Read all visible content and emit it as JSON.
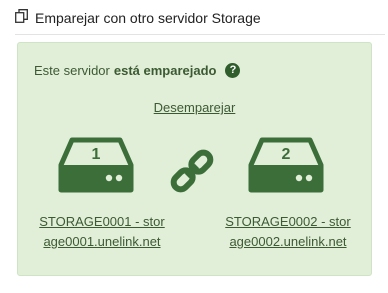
{
  "header": {
    "icon": "copy-icon",
    "title": "Emparejar con otro servidor Storage"
  },
  "pairing": {
    "status_prefix": "Este servidor",
    "status_strong": "está emparejado",
    "help_icon": "question-circle-icon",
    "help_glyph": "?",
    "unpair_label": "Desemparejar",
    "link_icon": "chain-link-icon",
    "servers": [
      {
        "number": "1",
        "icon": "hdd-icon",
        "line1": "STORAGE0001 - stor",
        "line2": "age0001.unelink.net"
      },
      {
        "number": "2",
        "icon": "hdd-icon",
        "line1": "STORAGE0002 - stor",
        "line2": "age0002.unelink.net"
      }
    ]
  },
  "colors": {
    "card_bg": "#e1efd9",
    "accent_dark": "#3c6e3a",
    "text": "#3c5a32"
  }
}
